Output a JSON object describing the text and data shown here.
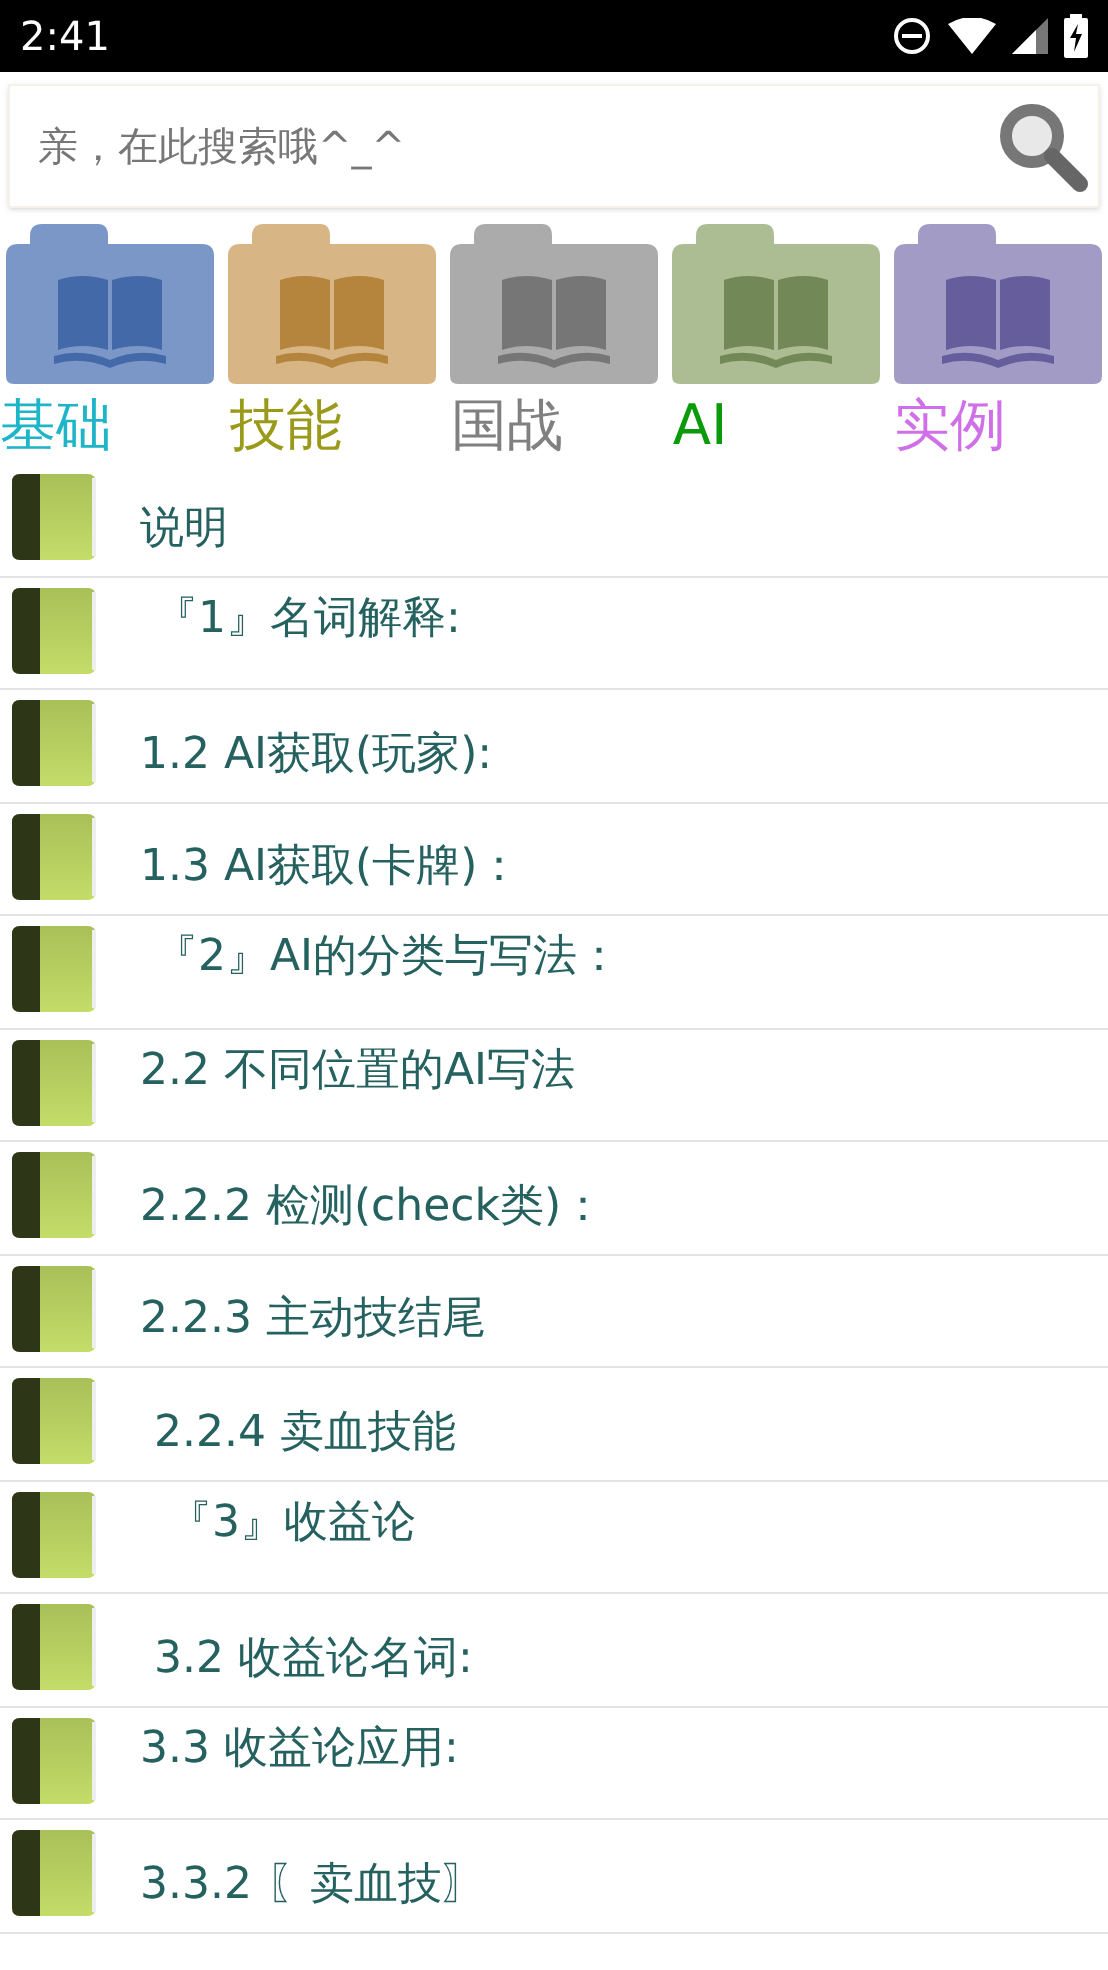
{
  "status_bar": {
    "time": "2:41"
  },
  "search": {
    "placeholder": "亲，在此搜索哦^_^"
  },
  "categories": [
    {
      "label": "基础",
      "color": "#1fb5c8"
    },
    {
      "label": "技能",
      "color": "#9a9a1a"
    },
    {
      "label": "国战",
      "color": "#808080"
    },
    {
      "label": "AI",
      "color": "#0a9a0a"
    },
    {
      "label": "实例",
      "color": "#d070e8"
    }
  ],
  "items": [
    {
      "title": "说明",
      "kind": "single"
    },
    {
      "title": " 『1』名词解释:",
      "kind": "double"
    },
    {
      "title": "1.2 AI获取(玩家):",
      "kind": "single"
    },
    {
      "title": "1.3 AI获取(卡牌)：",
      "kind": "single"
    },
    {
      "title": " 『2』AI的分类与写法：",
      "kind": "double"
    },
    {
      "title": "2.2 不同位置的AI写法",
      "kind": "double"
    },
    {
      "title": "2.2.2 检测(check类)：",
      "kind": "single"
    },
    {
      "title": "2.2.3 主动技结尾",
      "kind": "single"
    },
    {
      "title": " 2.2.4 卖血技能",
      "kind": "single"
    },
    {
      "title": "  『3』收益论",
      "kind": "double"
    },
    {
      "title": " 3.2 收益论名词:",
      "kind": "single"
    },
    {
      "title": "3.3 收益论应用:",
      "kind": "double"
    },
    {
      "title": "3.3.2 〖卖血技〗",
      "kind": "single"
    }
  ]
}
